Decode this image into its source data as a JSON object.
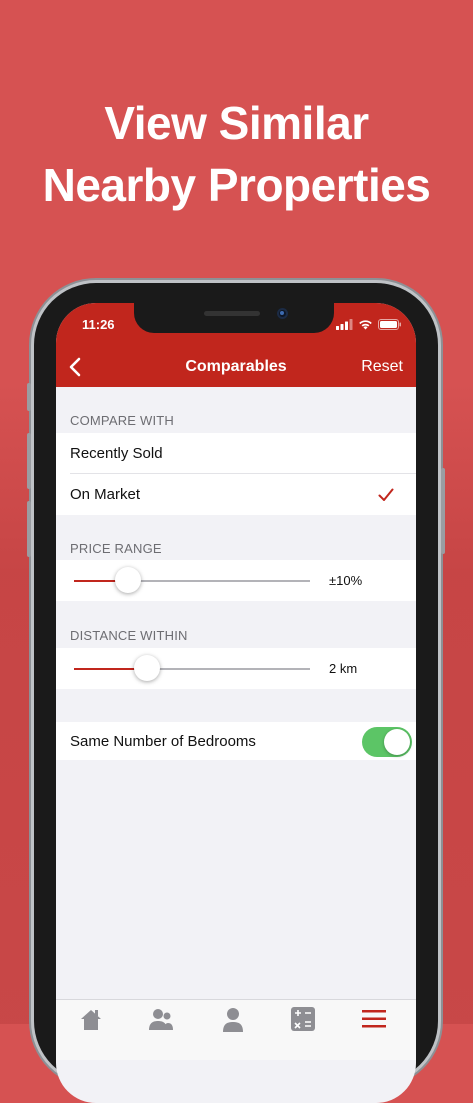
{
  "promo": {
    "headline_line1": "View Similar",
    "headline_line2": "Nearby Properties"
  },
  "status_bar": {
    "time": "11:26",
    "icons": [
      "signal-icon",
      "wifi-icon",
      "battery-icon"
    ]
  },
  "nav": {
    "title": "Comparables",
    "reset_label": "Reset",
    "back_icon": "chevron-left-icon"
  },
  "compare_with": {
    "header": "COMPARE WITH",
    "options": [
      {
        "label": "Recently Sold",
        "selected": false
      },
      {
        "label": "On Market",
        "selected": true
      }
    ]
  },
  "price_range": {
    "header": "PRICE RANGE",
    "value_label": "±10%",
    "level": 0.23
  },
  "distance": {
    "header": "DISTANCE WITHIN",
    "value_label": "2 km",
    "level": 0.31
  },
  "bedrooms": {
    "label": "Same Number of Bedrooms",
    "enabled": true
  },
  "tabbar": {
    "icons": [
      "home-icon",
      "people-icon",
      "person-icon",
      "calculator-icon",
      "menu-icon"
    ]
  },
  "colors": {
    "accent": "#c1261d",
    "background": "#d65252",
    "toggle_on": "#5cc566"
  }
}
